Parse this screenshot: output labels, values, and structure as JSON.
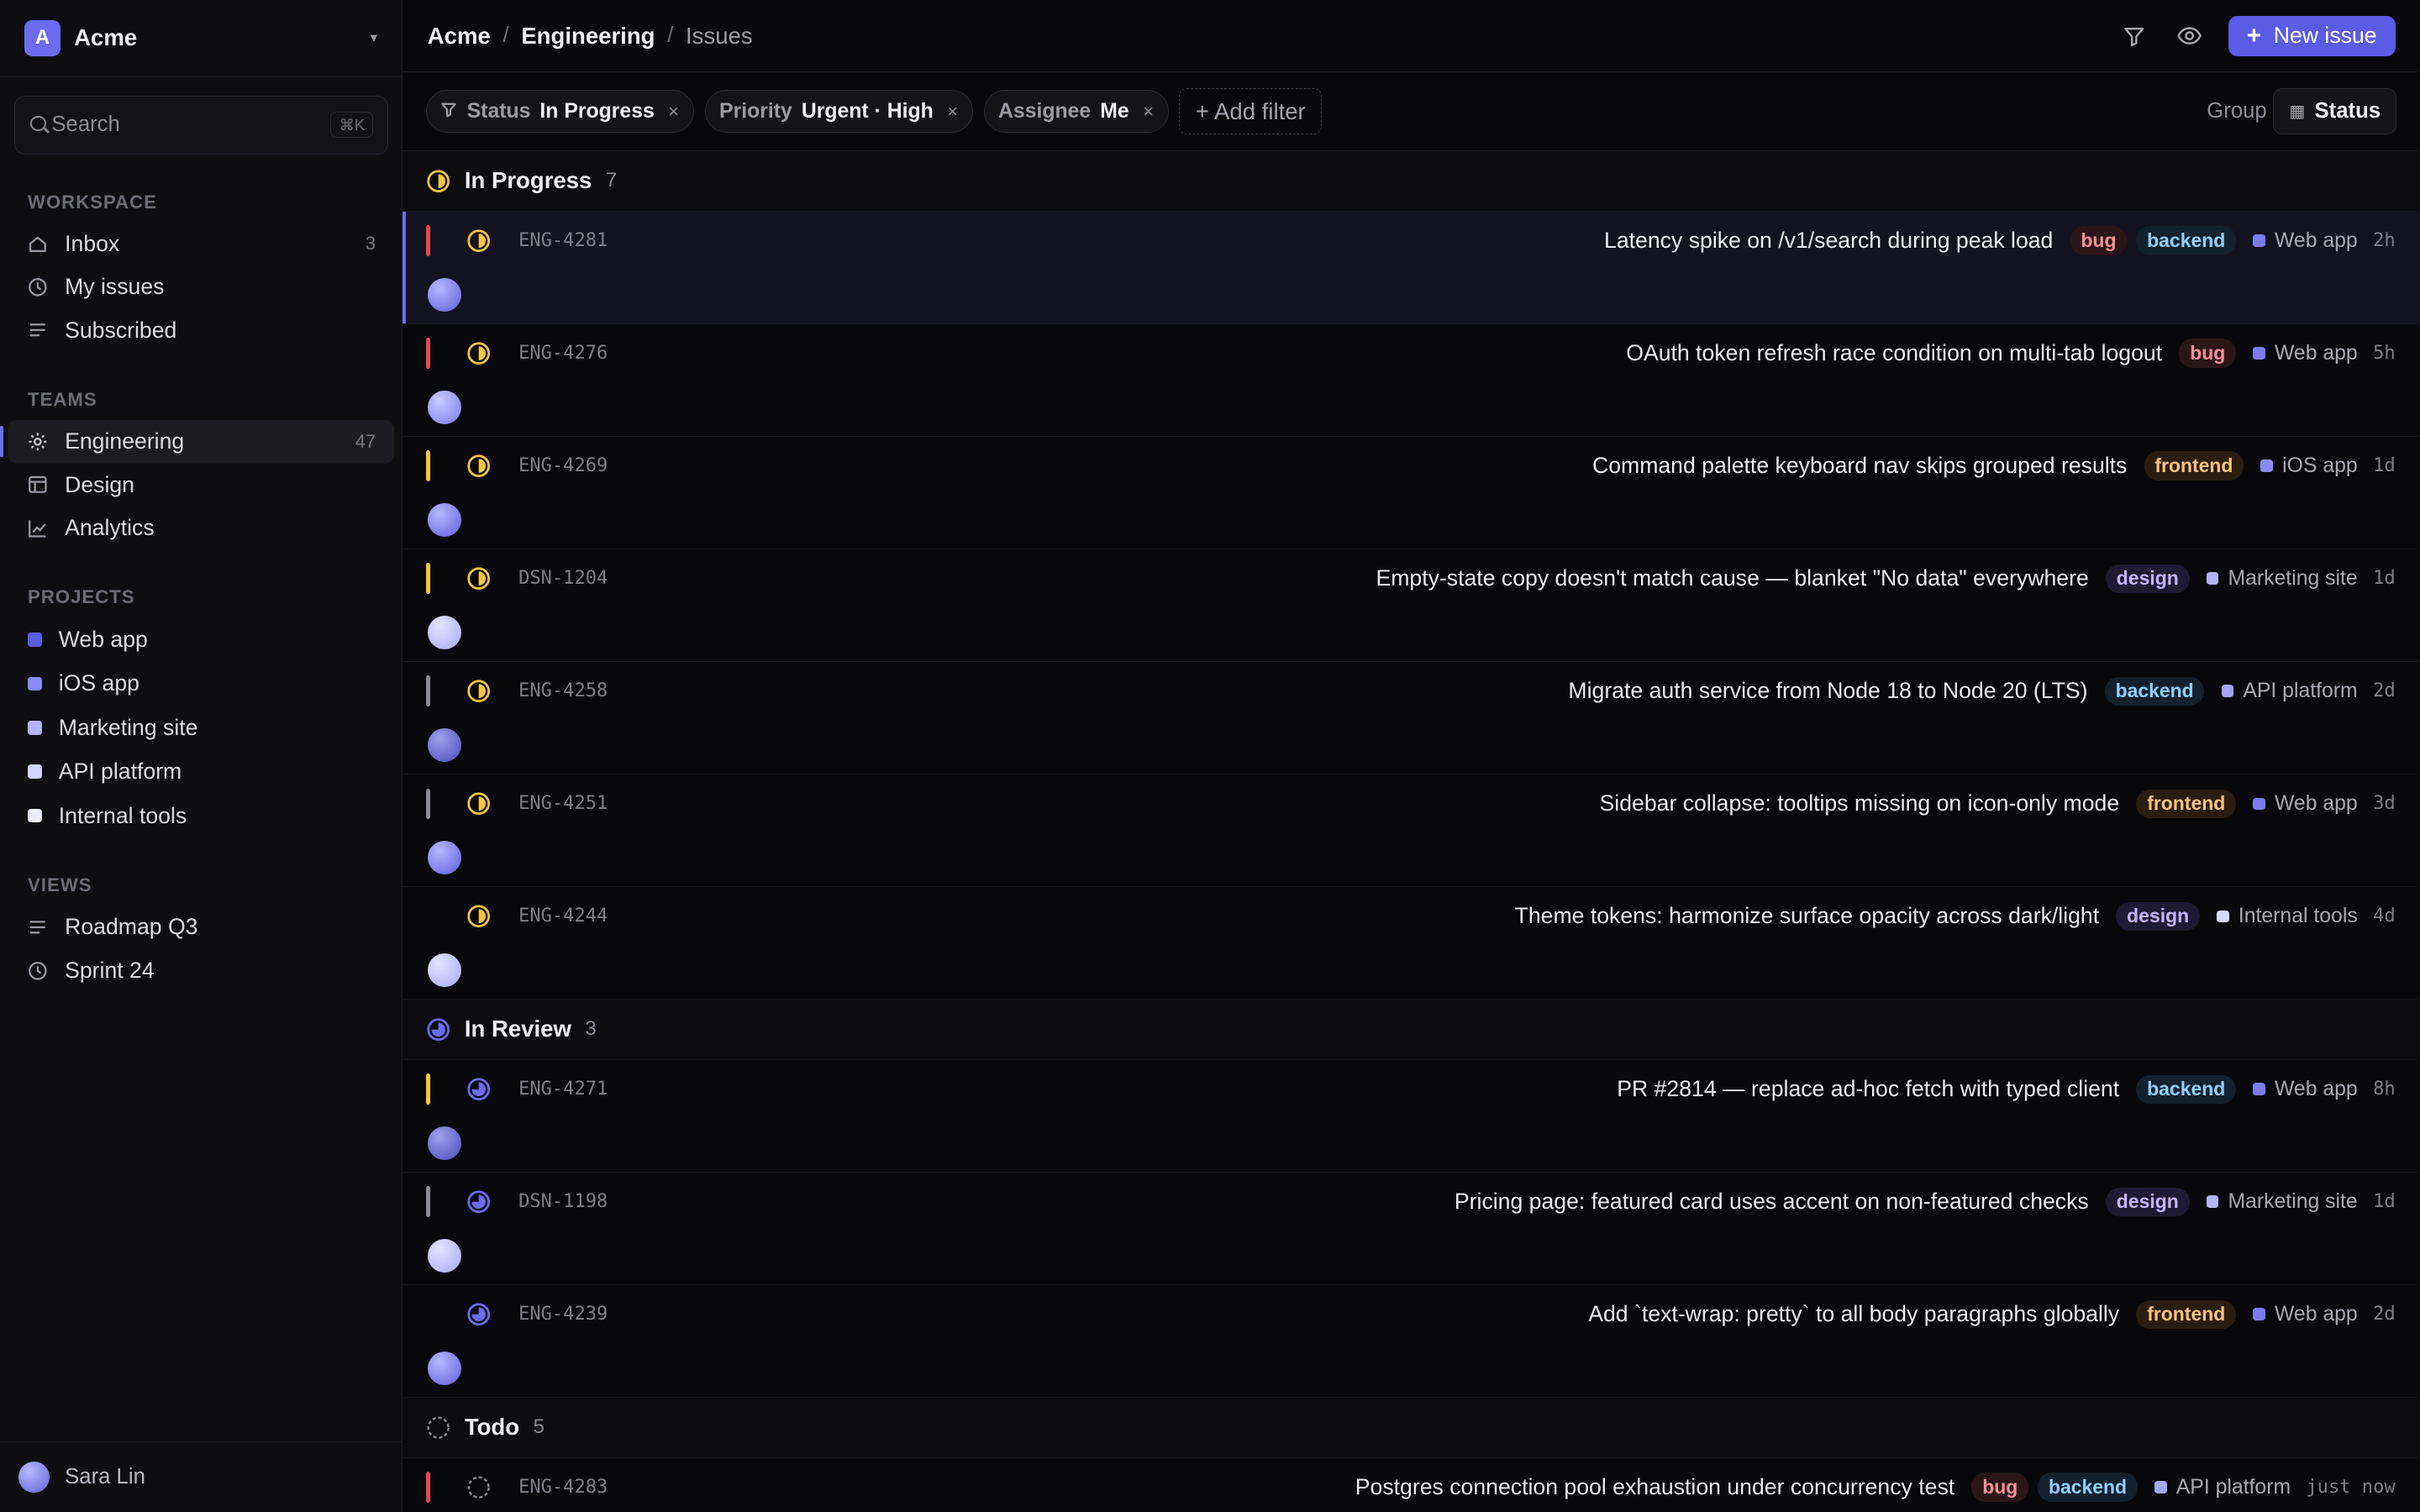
{
  "workspace": {
    "initial": "A",
    "name": "Acme",
    "chevron": "▾"
  },
  "search": {
    "placeholder": "Search",
    "shortcut": "⌘K"
  },
  "sidebar": {
    "workspace_label": "WORKSPACE",
    "workspace_items": [
      {
        "label": "Inbox",
        "icon": "inbox-icon",
        "count": "3"
      },
      {
        "label": "My issues",
        "icon": "clock-icon",
        "count": ""
      },
      {
        "label": "Subscribed",
        "icon": "list-icon",
        "count": ""
      }
    ],
    "teams_label": "TEAMS",
    "team_items": [
      {
        "label": "Engineering",
        "icon": "gear-icon",
        "count": "47",
        "active": true
      },
      {
        "label": "Design",
        "icon": "layout-icon",
        "count": ""
      },
      {
        "label": "Analytics",
        "icon": "chart-icon",
        "count": ""
      }
    ],
    "projects_label": "PROJECTS",
    "project_items": [
      {
        "label": "Web app",
        "color": "#5b5ce6"
      },
      {
        "label": "iOS app",
        "color": "#8a8cf5"
      },
      {
        "label": "Marketing site",
        "color": "#b3b4fb"
      },
      {
        "label": "API platform",
        "color": "#d2d3ff"
      },
      {
        "label": "Internal tools",
        "color": "#ececfb"
      }
    ],
    "views_label": "VIEWS",
    "view_items": [
      {
        "label": "Roadmap Q3",
        "icon": "list-icon"
      },
      {
        "label": "Sprint 24",
        "icon": "clock-icon"
      }
    ]
  },
  "user": {
    "name": "Sara Lin"
  },
  "breadcrumb": {
    "root": "Acme",
    "team": "Engineering",
    "page": "Issues",
    "sep": "/"
  },
  "toolbar": {
    "new_issue_label": "New issue"
  },
  "filters": [
    {
      "key": "Status",
      "value": "In Progress"
    },
    {
      "key": "Priority",
      "value": "Urgent · High"
    },
    {
      "key": "Assignee",
      "value": "Me"
    }
  ],
  "add_filter_label": "+ Add filter",
  "group": {
    "label": "Group",
    "value": "Status"
  },
  "colors": {
    "accent": "#5b5ce6",
    "urgent": "#e5484d",
    "high": "#f5c542",
    "medium": "#8b8b93",
    "in_progress": "#f5c542",
    "in_review": "#6b6cf0"
  },
  "groups": [
    {
      "title": "In Progress",
      "count": "7",
      "status": "in_progress",
      "issues": [
        {
          "id": "ENG-4281",
          "title": "Latency spike on /v1/search during peak load",
          "labels": [
            "bug",
            "backend"
          ],
          "project": "Web app",
          "project_color": "#7b7cf2",
          "time": "2h",
          "priority": "urgent",
          "selected": true,
          "avatar": "a1"
        },
        {
          "id": "ENG-4276",
          "title": "OAuth token refresh race condition on multi-tab logout",
          "labels": [
            "bug"
          ],
          "project": "Web app",
          "project_color": "#7b7cf2",
          "time": "5h",
          "priority": "urgent",
          "avatar": "a2"
        },
        {
          "id": "ENG-4269",
          "title": "Command palette keyboard nav skips grouped results",
          "labels": [
            "frontend"
          ],
          "project": "iOS app",
          "project_color": "#8a8cf5",
          "time": "1d",
          "priority": "high",
          "avatar": "a1"
        },
        {
          "id": "DSN-1204",
          "title": "Empty-state copy doesn't match cause — blanket \"No data\" everywhere",
          "labels": [
            "design"
          ],
          "project": "Marketing site",
          "project_color": "#b3b4fb",
          "time": "1d",
          "priority": "high",
          "avatar": "a3"
        },
        {
          "id": "ENG-4258",
          "title": "Migrate auth service from Node 18 to Node 20 (LTS)",
          "labels": [
            "backend"
          ],
          "project": "API platform",
          "project_color": "#a3a5f7",
          "time": "2d",
          "priority": "medium",
          "avatar": "a4"
        },
        {
          "id": "ENG-4251",
          "title": "Sidebar collapse: tooltips missing on icon-only mode",
          "labels": [
            "frontend"
          ],
          "project": "Web app",
          "project_color": "#7b7cf2",
          "time": "3d",
          "priority": "medium",
          "avatar": "a1"
        },
        {
          "id": "ENG-4244",
          "title": "Theme tokens: harmonize surface opacity across dark/light",
          "labels": [
            "design"
          ],
          "project": "Internal tools",
          "project_color": "#d8d9ff",
          "time": "4d",
          "priority": "none",
          "avatar": "a3"
        }
      ]
    },
    {
      "title": "In Review",
      "count": "3",
      "status": "in_review",
      "issues": [
        {
          "id": "ENG-4271",
          "title": "PR #2814 — replace ad-hoc fetch with typed client",
          "labels": [
            "backend"
          ],
          "project": "Web app",
          "project_color": "#7b7cf2",
          "time": "8h",
          "priority": "high",
          "avatar": "a4"
        },
        {
          "id": "DSN-1198",
          "title": "Pricing page: featured card uses accent on non-featured checks",
          "labels": [
            "design"
          ],
          "project": "Marketing site",
          "project_color": "#b3b4fb",
          "time": "1d",
          "priority": "medium",
          "avatar": "a3"
        },
        {
          "id": "ENG-4239",
          "title": "Add `text-wrap: pretty` to all body paragraphs globally",
          "labels": [
            "frontend"
          ],
          "project": "Web app",
          "project_color": "#7b7cf2",
          "time": "2d",
          "priority": "none",
          "avatar": "a1"
        }
      ]
    },
    {
      "title": "Todo",
      "count": "5",
      "status": "todo",
      "issues": [
        {
          "id": "ENG-4283",
          "title": "Postgres connection pool exhaustion under concurrency test",
          "labels": [
            "bug",
            "backend"
          ],
          "project": "API platform",
          "project_color": "#a3a5f7",
          "time": "just now",
          "priority": "urgent",
          "avatar": "a1"
        }
      ]
    }
  ]
}
